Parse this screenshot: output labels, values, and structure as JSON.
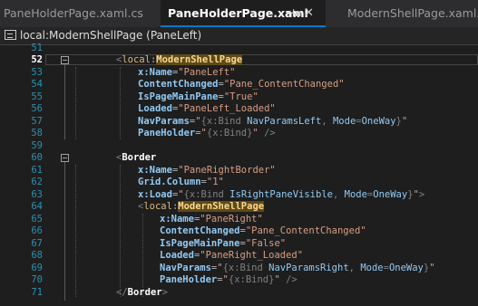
{
  "tabs": [
    {
      "label": "PaneHolderPage.xaml.cs"
    },
    {
      "label": "PaneHolderPage.xaml"
    },
    {
      "label": "ModernShellPage.xaml.cs"
    }
  ],
  "breadcrumb": "local:ModernShellPage (PaneLeft)",
  "current_line": "52",
  "lines": [
    {
      "n": "51"
    },
    {
      "n": "52"
    },
    {
      "n": "53"
    },
    {
      "n": "54"
    },
    {
      "n": "55"
    },
    {
      "n": "56"
    },
    {
      "n": "57"
    },
    {
      "n": "58"
    },
    {
      "n": "59"
    },
    {
      "n": "60"
    },
    {
      "n": "61"
    },
    {
      "n": "62"
    },
    {
      "n": "63"
    },
    {
      "n": "64"
    },
    {
      "n": "65"
    },
    {
      "n": "66"
    },
    {
      "n": "67"
    },
    {
      "n": "68"
    },
    {
      "n": "69"
    },
    {
      "n": "70"
    },
    {
      "n": "71"
    }
  ],
  "code": {
    "l52": {
      "open": "<",
      "ns": "local",
      "colon": ":",
      "tag": "ModernShellPage"
    },
    "l53": {
      "attr": "x:Name",
      "eq": "=",
      "value": "\"PaneLeft\""
    },
    "l54": {
      "attr": "ContentChanged",
      "eq": "=",
      "value": "\"Pane_ContentChanged\""
    },
    "l55": {
      "attr": "IsPageMainPane",
      "eq": "=",
      "value": "\"True\""
    },
    "l56": {
      "attr": "Loaded",
      "eq": "=",
      "value": "\"PaneLeft_Loaded\""
    },
    "l57": {
      "attr": "NavParams",
      "eq": "=",
      "q1": "\"",
      "mk": "{x:Bind ",
      "arg": "NavParamsLeft",
      "cm": ", ",
      "mode": "Mode",
      "meq": "=",
      "modev": "OneWay",
      "mc": "}",
      "q2": "\""
    },
    "l58": {
      "attr": "PaneHolder",
      "eq": "=",
      "q1": "\"",
      "mk": "{x:Bind}",
      "q2": "\"",
      "end": " />"
    },
    "l60": {
      "open": "<",
      "tag": "Border"
    },
    "l61": {
      "attr": "x:Name",
      "eq": "=",
      "value": "\"PaneRightBorder\""
    },
    "l62": {
      "attr": "Grid.Column",
      "eq": "=",
      "value": "\"1\""
    },
    "l63": {
      "attr": "x:Load",
      "eq": "=",
      "q1": "\"",
      "mk": "{x:Bind ",
      "arg": "IsRightPaneVisible",
      "cm": ", ",
      "mode": "Mode",
      "meq": "=",
      "modev": "OneWay",
      "mc": "}",
      "q2": "\"",
      "end": ">"
    },
    "l64": {
      "open": "<",
      "ns": "local",
      "colon": ":",
      "tag": "ModernShellPage"
    },
    "l65": {
      "attr": "x:Name",
      "eq": "=",
      "value": "\"PaneRight\""
    },
    "l66": {
      "attr": "ContentChanged",
      "eq": "=",
      "value": "\"Pane_ContentChanged\""
    },
    "l67": {
      "attr": "IsPageMainPane",
      "eq": "=",
      "value": "\"False\""
    },
    "l68": {
      "attr": "Loaded",
      "eq": "=",
      "value": "\"PaneRight_Loaded\""
    },
    "l69": {
      "attr": "NavParams",
      "eq": "=",
      "q1": "\"",
      "mk": "{x:Bind ",
      "arg": "NavParamsRight",
      "cm": ", ",
      "mode": "Mode",
      "meq": "=",
      "modev": "OneWay",
      "mc": "}",
      "q2": "\""
    },
    "l70": {
      "attr": "PaneHolder",
      "eq": "=",
      "q1": "\"",
      "mk": "{x:Bind}",
      "q2": "\"",
      "end": " />"
    },
    "l71": {
      "open": "</",
      "tag": "Border",
      "close": ">"
    }
  },
  "colors": {
    "accent": "#007acc",
    "editor_bg": "#1e1e1e",
    "line_number": "#2b91af",
    "attribute": "#92caf4",
    "string": "#d69d85",
    "highlight": "#5c4a1b"
  }
}
